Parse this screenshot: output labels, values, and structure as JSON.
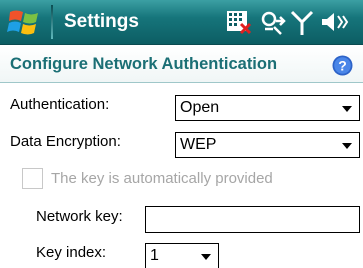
{
  "titlebar": {
    "title": "Settings",
    "icons": [
      "windows-start-icon",
      "sim-card-missing-icon",
      "connectivity-icon",
      "signal-icon",
      "speaker-muted-icon"
    ]
  },
  "header": {
    "title": "Configure Network Authentication",
    "help_icon": "help-icon"
  },
  "form": {
    "authentication": {
      "label": "Authentication:",
      "value": "Open"
    },
    "data_encryption": {
      "label": "Data Encryption:",
      "value": "WEP"
    },
    "auto_key": {
      "label": "The key is automatically provided",
      "checked": false,
      "enabled": false
    },
    "network_key": {
      "label": "Network key:",
      "value": ""
    },
    "key_index": {
      "label": "Key index:",
      "value": "1"
    }
  },
  "colors": {
    "titlebar": "#16757b",
    "header_text": "#1b6f75",
    "disabled_text": "#a6a6a6"
  }
}
